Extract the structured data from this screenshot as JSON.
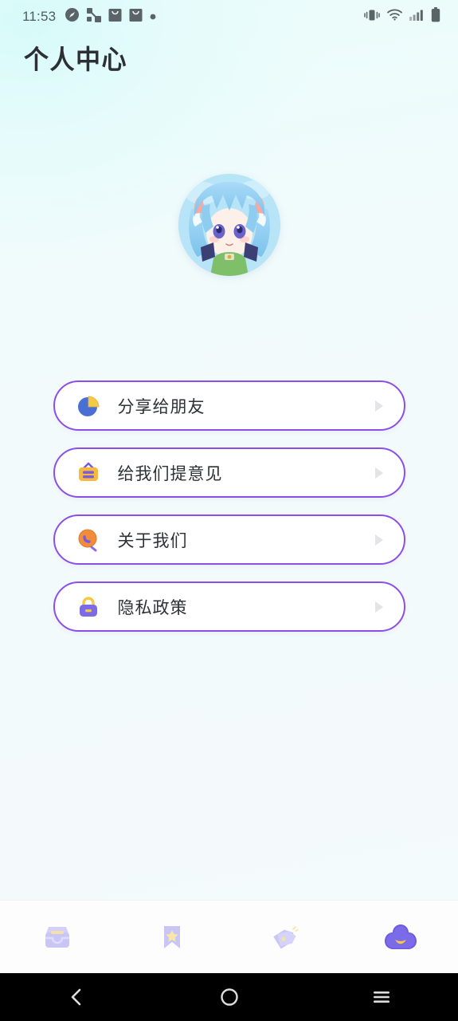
{
  "statusbar": {
    "time": "11:53",
    "left_icons": [
      "compass-icon",
      "share-network-icon",
      "shopping-bag-icon",
      "shopping-bag-icon",
      "dot-icon"
    ],
    "right_icons": [
      "vibrate-icon",
      "wifi-icon",
      "signal-icon",
      "battery-icon"
    ]
  },
  "header": {
    "title": "个人中心"
  },
  "profile": {
    "avatar_alt": "anime-character-avatar"
  },
  "menu": {
    "items": [
      {
        "label": "分享给朋友",
        "icon": "pie-chart-share-icon",
        "arrow": "chevron-right-triangle-icon"
      },
      {
        "label": "给我们提意见",
        "icon": "feedback-board-icon",
        "arrow": "chevron-right-triangle-icon"
      },
      {
        "label": "关于我们",
        "icon": "magnifier-circle-icon",
        "arrow": "chevron-right-triangle-icon"
      },
      {
        "label": "隐私政策",
        "icon": "lock-icon",
        "arrow": "chevron-right-triangle-icon"
      }
    ]
  },
  "tabbar": {
    "items": [
      {
        "name": "inbox-tab",
        "icon": "inbox-tray-icon",
        "active": false
      },
      {
        "name": "favorites-tab",
        "icon": "bookmark-star-icon",
        "active": false
      },
      {
        "name": "tags-tab",
        "icon": "price-tags-icon",
        "active": false
      },
      {
        "name": "profile-tab",
        "icon": "cloud-profile-icon",
        "active": true
      }
    ]
  },
  "navbar": {
    "back": "back-chevron-icon",
    "home": "home-circle-icon",
    "recents": "recents-menu-icon"
  },
  "colors": {
    "accent_purple": "#8b4fe8",
    "icon_lavender": "#c6c4f5",
    "icon_yellow": "#f5c945",
    "background_top": "#eafcfb",
    "card_white": "#ffffff",
    "text_dark": "#2e3136"
  }
}
